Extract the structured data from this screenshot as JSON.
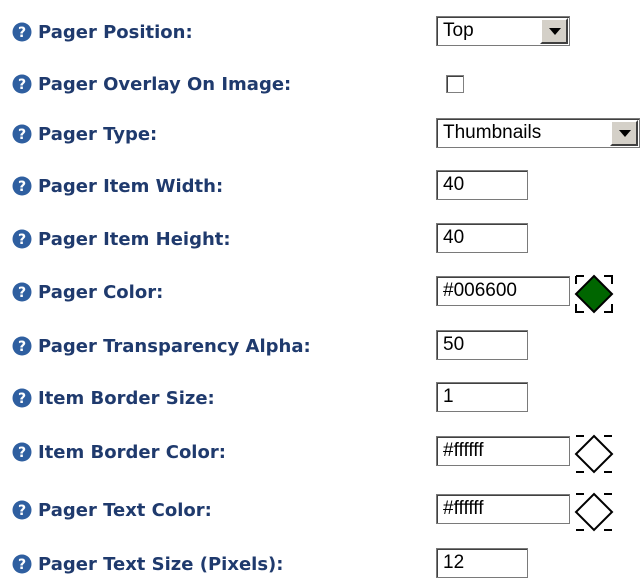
{
  "fields": {
    "pager_position": {
      "label": "Pager Position:",
      "value": "Top"
    },
    "pager_overlay": {
      "label": "Pager Overlay On Image:",
      "checked": false
    },
    "pager_type": {
      "label": "Pager Type:",
      "value": "Thumbnails"
    },
    "item_width": {
      "label": "Pager Item Width:",
      "value": "40"
    },
    "item_height": {
      "label": "Pager Item Height:",
      "value": "40"
    },
    "pager_color": {
      "label": "Pager Color:",
      "value": "#006600"
    },
    "transparency": {
      "label": "Pager Transparency Alpha:",
      "value": "50"
    },
    "border_size": {
      "label": "Item Border Size:",
      "value": "1"
    },
    "border_color": {
      "label": "Item Border Color:",
      "value": "#ffffff"
    },
    "text_color": {
      "label": "Pager Text Color:",
      "value": "#ffffff"
    },
    "text_size": {
      "label": "Pager Text Size (Pixels):",
      "value": "12"
    }
  },
  "colors": {
    "label": "#1f3a6d",
    "help_icon": "#2f5fa0",
    "pager_swatch": "#006600",
    "white_swatch": "#ffffff"
  },
  "icons": {
    "help": "help-question-icon",
    "swatch": "color-picker-icon",
    "dropdown": "chevron-down-icon"
  }
}
